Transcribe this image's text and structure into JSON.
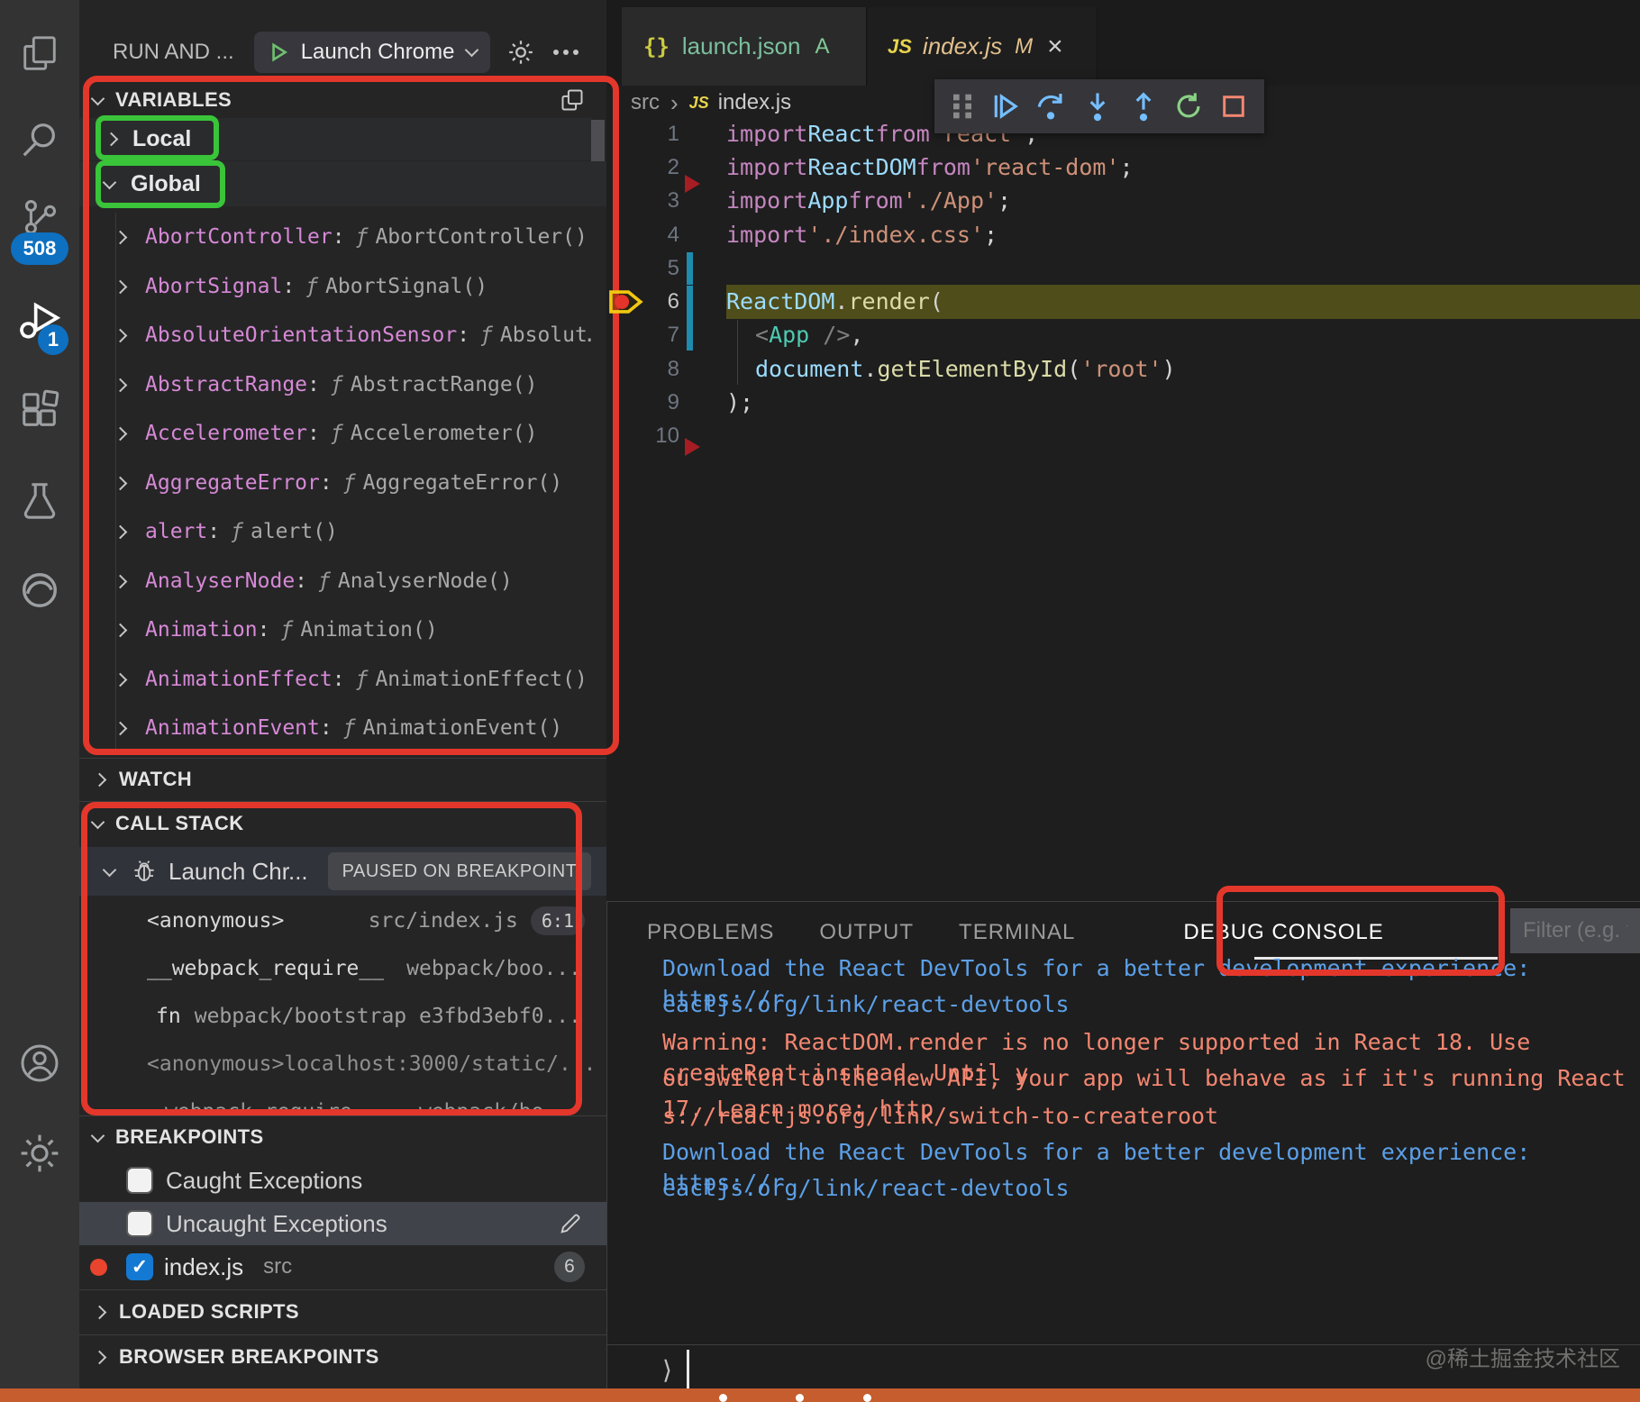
{
  "activity_bar": {
    "source_control_badge": "508",
    "debug_badge": "1"
  },
  "sidebar": {
    "title": "RUN AND ...",
    "launch_button_label": "Launch Chrome",
    "variables": {
      "title": "VARIABLES",
      "scopes": [
        {
          "label": "Local"
        },
        {
          "label": "Global"
        }
      ],
      "items": [
        {
          "name": "AbortController",
          "fn": "ƒ",
          "value": "AbortController()"
        },
        {
          "name": "AbortSignal",
          "fn": "ƒ",
          "value": "AbortSignal()"
        },
        {
          "name": "AbsoluteOrientationSensor",
          "fn": "ƒ",
          "value": "Absolut…"
        },
        {
          "name": "AbstractRange",
          "fn": "ƒ",
          "value": "AbstractRange()"
        },
        {
          "name": "Accelerometer",
          "fn": "ƒ",
          "value": "Accelerometer()"
        },
        {
          "name": "AggregateError",
          "fn": "ƒ",
          "value": "AggregateError()"
        },
        {
          "name": "alert",
          "fn": "ƒ",
          "value": "alert()"
        },
        {
          "name": "AnalyserNode",
          "fn": "ƒ",
          "value": "AnalyserNode()"
        },
        {
          "name": "Animation",
          "fn": "ƒ",
          "value": "Animation()"
        },
        {
          "name": "AnimationEffect",
          "fn": "ƒ",
          "value": "AnimationEffect()"
        },
        {
          "name": "AnimationEvent",
          "fn": "ƒ",
          "value": "AnimationEvent()"
        }
      ]
    },
    "watch": {
      "title": "WATCH"
    },
    "call_stack": {
      "title": "CALL STACK",
      "session": "Launch Chr...",
      "status_badge": "PAUSED ON BREAKPOINT",
      "frames": [
        {
          "name": "<anonymous>",
          "location": "src/index.js",
          "badge": "6:1"
        },
        {
          "name": "__webpack_require__",
          "location": "webpack/boo..."
        },
        {
          "name": "fn",
          "location": "webpack/bootstrap e3fbd3ebf0..."
        },
        {
          "name": "<anonymous>",
          "location": "localhost:3000/static/..."
        },
        {
          "name": "webpack_require...",
          "location": "webpack/bo..."
        }
      ]
    },
    "breakpoints": {
      "title": "BREAKPOINTS",
      "caught_label": "Caught Exceptions",
      "uncaught_label": "Uncaught Exceptions",
      "file_breakpoint": {
        "label": "index.js",
        "detail": "src",
        "badge": "6"
      }
    },
    "loaded_scripts_title": "LOADED SCRIPTS",
    "browser_breakpoints_title": "BROWSER BREAKPOINTS"
  },
  "editor": {
    "tabs": [
      {
        "icon": "{}",
        "name": "launch.json",
        "badge": "A"
      },
      {
        "icon": "JS",
        "name": "index.js",
        "badge": "M",
        "close": "×"
      }
    ],
    "breadcrumb": {
      "folder": "src",
      "sep": "›",
      "file_icon": "JS",
      "file": "index.js"
    },
    "gutter": [
      "1",
      "2",
      "3",
      "4",
      "5",
      "6",
      "7",
      "8",
      "9",
      "10"
    ],
    "code": {
      "lines": [
        {
          "tokens": [
            {
              "t": "import "
            },
            {
              "t": "React "
            },
            {
              "t": "from "
            },
            {
              "t": "'react'"
            },
            {
              "t": ";"
            }
          ]
        },
        {
          "tokens": [
            {
              "t": "import "
            },
            {
              "t": "ReactDOM "
            },
            {
              "t": "from "
            },
            {
              "t": "'react-dom'"
            },
            {
              "t": ";"
            }
          ]
        },
        {
          "tokens": [
            {
              "t": "import "
            },
            {
              "t": "App "
            },
            {
              "t": "from "
            },
            {
              "t": "'./App'"
            },
            {
              "t": ";"
            }
          ]
        },
        {
          "tokens": [
            {
              "t": "import "
            },
            {
              "t": "'./index.css'"
            },
            {
              "t": ";"
            }
          ]
        },
        {
          "tokens": []
        },
        {
          "tokens": [
            {
              "t": "ReactDOM"
            },
            {
              "t": "."
            },
            {
              "t": "render"
            },
            {
              "t": "("
            }
          ]
        },
        {
          "tokens": [
            {
              "t": "<"
            },
            {
              "t": "App"
            },
            {
              "t": " />"
            },
            {
              "t": ","
            }
          ]
        },
        {
          "tokens": [
            {
              "t": "document"
            },
            {
              "t": "."
            },
            {
              "t": "getElementById"
            },
            {
              "t": "("
            },
            {
              "t": "'root'"
            },
            {
              "t": ")"
            }
          ]
        },
        {
          "tokens": [
            {
              "t": ");"
            }
          ]
        },
        {
          "tokens": []
        }
      ]
    }
  },
  "panel": {
    "tabs": [
      {
        "label": "PROBLEMS"
      },
      {
        "label": "OUTPUT"
      },
      {
        "label": "TERMINAL"
      },
      {
        "label": "DEBUG CONSOLE"
      }
    ],
    "filter_placeholder": "Filter (e.g. te",
    "console_lines": [
      {
        "text": "Download the React DevTools for a better development experience: https://r"
      },
      {
        "text": "eactjs.org/link/react-devtools"
      },
      {
        "text": "Warning: ReactDOM.render is no longer supported in React 18. Use createRoot instead. Until y"
      },
      {
        "text": "ou switch to the new API, your app will behave as if it's running React 17. Learn more: http"
      },
      {
        "text": "s://reactjs.org/link/switch-to-createroot"
      },
      {
        "text": "Download the React DevTools for a better development experience: https://r"
      },
      {
        "text": "eactjs.org/link/react-devtools"
      }
    ],
    "prompt": "⟩",
    "watermark": "@稀土掘金技术社区"
  }
}
